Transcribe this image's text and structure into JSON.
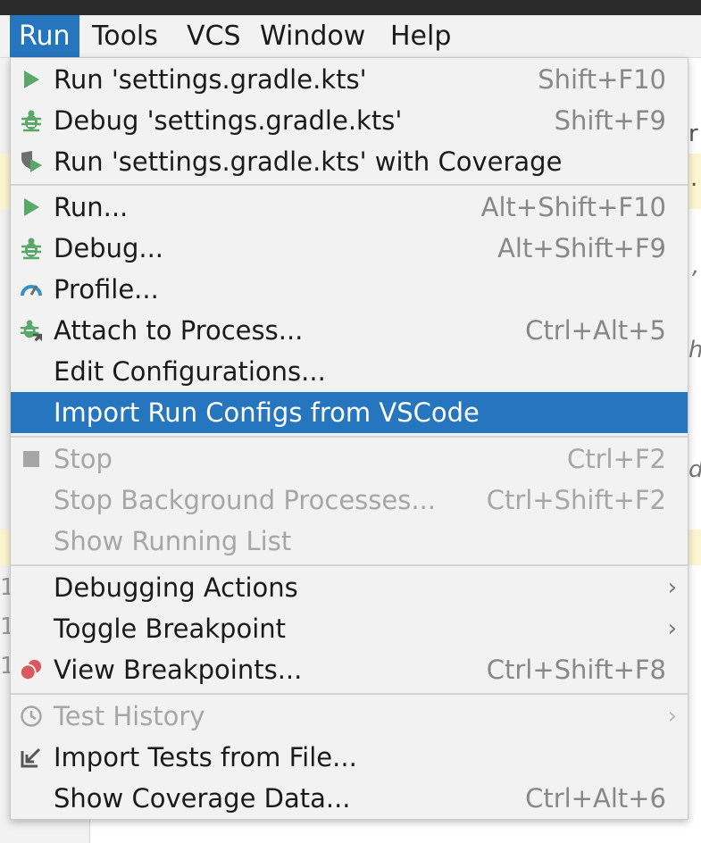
{
  "menubar": {
    "items": [
      {
        "label": "Run",
        "active": true
      },
      {
        "label": "Tools"
      },
      {
        "label": "VCS"
      },
      {
        "label": "Window"
      },
      {
        "label": "Help"
      }
    ]
  },
  "background": {
    "glyphs": [
      "r",
      ".",
      ",",
      "h",
      "d",
      "1",
      "1",
      "1"
    ]
  },
  "menu": {
    "items": [
      {
        "label": "Run 'settings.gradle.kts'",
        "shortcut": "Shift+F10",
        "icon": "run-triangle-icon"
      },
      {
        "label": "Debug 'settings.gradle.kts'",
        "shortcut": "Shift+F9",
        "icon": "debug-bug-icon"
      },
      {
        "label": "Run 'settings.gradle.kts' with Coverage",
        "shortcut": "",
        "icon": "coverage-shield-icon"
      },
      {
        "label": "Run...",
        "shortcut": "Alt+Shift+F10",
        "icon": "run-triangle-icon"
      },
      {
        "label": "Debug...",
        "shortcut": "Alt+Shift+F9",
        "icon": "debug-bug-icon"
      },
      {
        "label": "Profile...",
        "shortcut": "",
        "icon": "profile-gauge-icon"
      },
      {
        "label": "Attach to Process...",
        "shortcut": "Ctrl+Alt+5",
        "icon": "attach-bug-icon"
      },
      {
        "label": "Edit Configurations...",
        "shortcut": ""
      },
      {
        "label": "Import Run Configs from VSCode",
        "shortcut": "",
        "selected": true
      },
      {
        "label": "Stop",
        "shortcut": "Ctrl+F2",
        "icon": "stop-square-icon",
        "disabled": true
      },
      {
        "label": "Stop Background Processes...",
        "shortcut": "Ctrl+Shift+F2",
        "disabled": true
      },
      {
        "label": "Show Running List",
        "shortcut": "",
        "disabled": true
      },
      {
        "label": "Debugging Actions",
        "shortcut": "",
        "submenu": true
      },
      {
        "label": "Toggle Breakpoint",
        "shortcut": "",
        "submenu": true
      },
      {
        "label": "View Breakpoints...",
        "shortcut": "Ctrl+Shift+F8",
        "icon": "breakpoints-icon"
      },
      {
        "label": "Test History",
        "shortcut": "",
        "icon": "clock-icon",
        "disabled": true,
        "submenu": true
      },
      {
        "label": "Import Tests from File...",
        "shortcut": "",
        "icon": "import-arrow-icon"
      },
      {
        "label": "Show Coverage Data...",
        "shortcut": "Ctrl+Alt+6"
      }
    ],
    "colors": {
      "selection": "#2675bf",
      "run_green": "#59a869",
      "breakpoint_red": "#db5860",
      "profile_blue": "#3592c4"
    }
  }
}
